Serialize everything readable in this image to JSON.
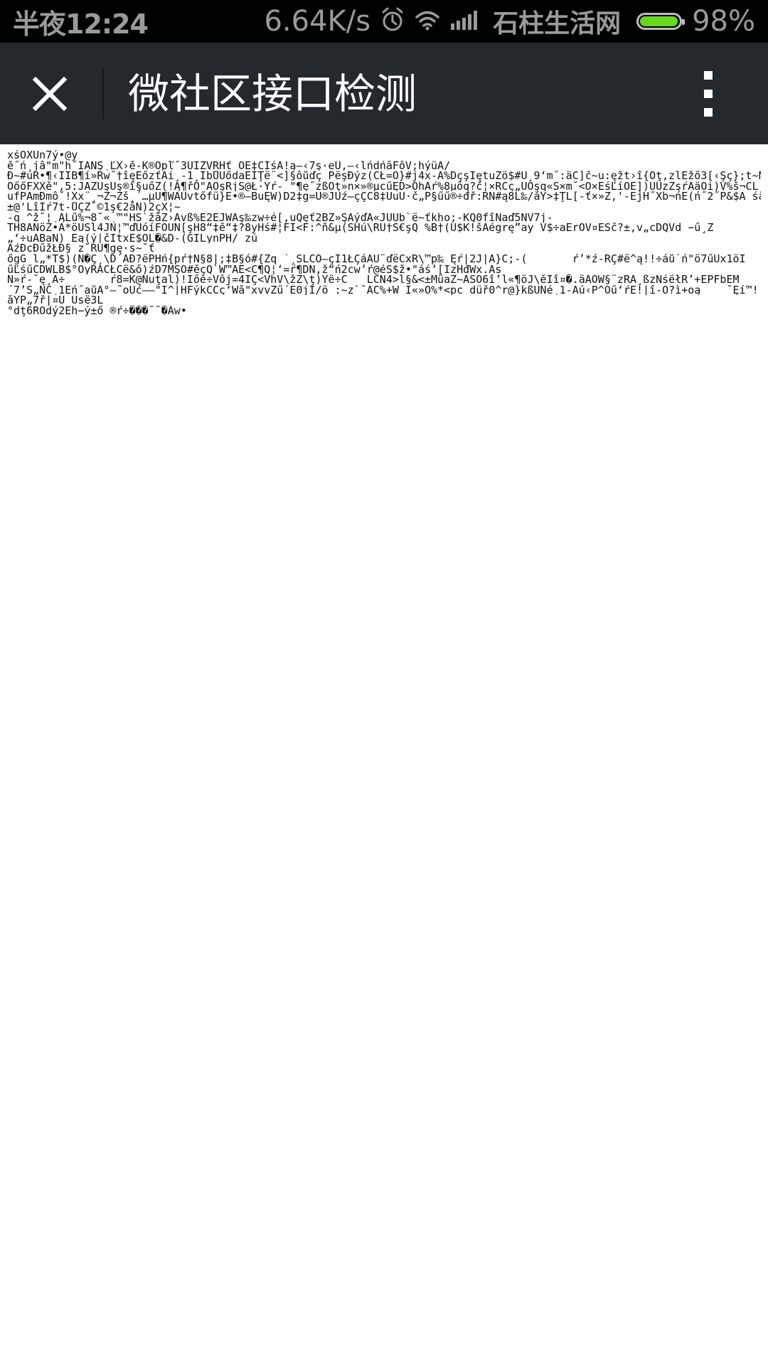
{
  "status_bar": {
    "time": "半夜12:24",
    "network_speed": "6.64K/s",
    "carrier": "石柱生活网",
    "battery_percent": "98%",
    "battery_level": 0.98,
    "icons": [
      "alarm-icon",
      "wifi-icon",
      "signal-icon",
      "battery-icon"
    ]
  },
  "app_bar": {
    "title": "微社区接口检测",
    "close_icon": "close-icon",
    "more_icon": "more-vertical-icon"
  },
  "content": {
    "lines": [
      "xśÔXŰn7ý•@y",
      "ě˝ń¸jâ\"m\"h˝ĪAŃŞ¸ĽX›ě-K®Ôpľ˝3ŰÍZVŘHť ÔE‡CÎśĂ!ą—‹7ş·eŰ,–‹lńdńăFôV;hýüĂ/",
      "Đ~#úŘ•¶‹ÎÎB¶í»Rw˝†îęEőzťÄi¸-1¸ÎbŮUődaEÍŢë¨<]§ôůďç PëşĐýz(ČŁ=Ô}#j4x-Â%DçşÍętuZö$#Ű¸9‘m˝:äĆ]č~u:ęžt›î{Oţ,zlËžő3[‹Şç};t~N-",
      "ÓőőFXXě\",5:JAZÚşUş®î§uőZ(!Ą¶řÔ\"AÓşRjŚ@Ł·Ýŕ- \"¶ę˝zßÖţ»n×»®µcűĘĎ>ÔhĂŕ%8µôq?č¦×ŘCç„ÚÔşq«S×m˘<Ó×ĔśĽíÖË])ÜUzZşŕÄäÔi)V%š¬ĆL",
      "ufPĂmĐmô˘!Xx¨¸¬Ž¬Žš¸´…µÜ¶WÂUvtőfü}E•®—BuĘW)D2‡g=Ú®JÜź—çÇČ8‡ÜuÚ·č„P§űű®÷đř:ŘŃ#ą8Ĺ‰/ăY>‡ŢĹ[-ť×»Ž,'-ËjH˝Xb¬ńË(ń˝2˝P&$Ä śä",
      "±@'LîÎŕ7t-ŮÇŽ˘©1ş€2ăŃ)2çX¦~",
      "-q ^ž˘¦¸ĄĹű%¬8˘«¸™\"HŚ`žăŽ›Âvß%Ě2EJWÂş‰zw÷é[,uQęť2BŽ»ŞÁýďĂ«JŰUb`ë~ťkho;-KQ0fîNaď5ŇV7j-",
      "TH8ÁNöŽ•Á*öÜŚl4JŃ¦™ďÜóíFOÜŃ[şH8“‡ě“‡?8yHś#¦FÍ<F:^ň&µ(SHú\\RÜ†Ś€şQ %B†(Ü$K!šÁégrę”ay_V$÷aErOV¤ÉŠč?±,v„cĎQVd_−ű¸Ž",
      "„‘÷uABaN) Ëą(ý|čÎtxĚ$ÓL�&Ď-(GÍLynPH/_zú",
      "AźĐcĐűžŁĐ§_z˘RÜ¶gę·s~˘ť",
      "őgG ĺ„*Ť$)(Ň�Ç¸\\Ď´AĐ?ëPHń{pŕ†Ň§8|;‡B§ó#{Žq ˙¸ŠLĆO—çI1ŁÇáÂÜ¨ďëĆxŘ\\™p‰ Ęŕ|2J|Ă}Č;-(       ŕ’*ź-RÇ#ë^ą!!÷áů˙ń\"ö7űŰx1öÍ",
      "űĽśűČDWLB$°ÓyRÁČŁĆë&ő)źĎ7MŞÖ#ěçQ`W™ÁË<Č¶Q¦‘=ŕ¶DŃ,ž“ń2cw’ŕ@éS$ž•\"áś’[IzHđWx.Âs",
      "Ń»ŕ-˘ę¸Á÷       ŕ8=K@Nuţaĺ)!Íőě÷Vôj=4ÍÇ<VhV\\žŽ\\ţ)Ýë÷C   LCŃ4>ĺ§&<±MüaŽ~ÄSÓ6î’l«¶öJ\\ěÎî¤�.äÄOW§¨zŘÁ¸ßzŃśëłŘ’+ĚPFbĚM",
      "´7’Ś„NČ¸1Eń˝aůÁ°—˝oÜć——\"I^|HFýkĆČç‘Wă\"xvvZű´Ë0jÎ/ö :~z`˘ÂC%+W Î«»Ô%*<pc düř0^r@}kßŰŃé¸1-Áú‹P^Óű‘ŕE!|î-Ô?ì+oą    ˘Ęí™!",
      "ăÝP„7ř|¤Ű_Üsë3Ĺ",
      "°dţ6ŘÓdý2Ëh−ý±ő_®ŕ÷���˘˘�Ăw•"
    ]
  }
}
